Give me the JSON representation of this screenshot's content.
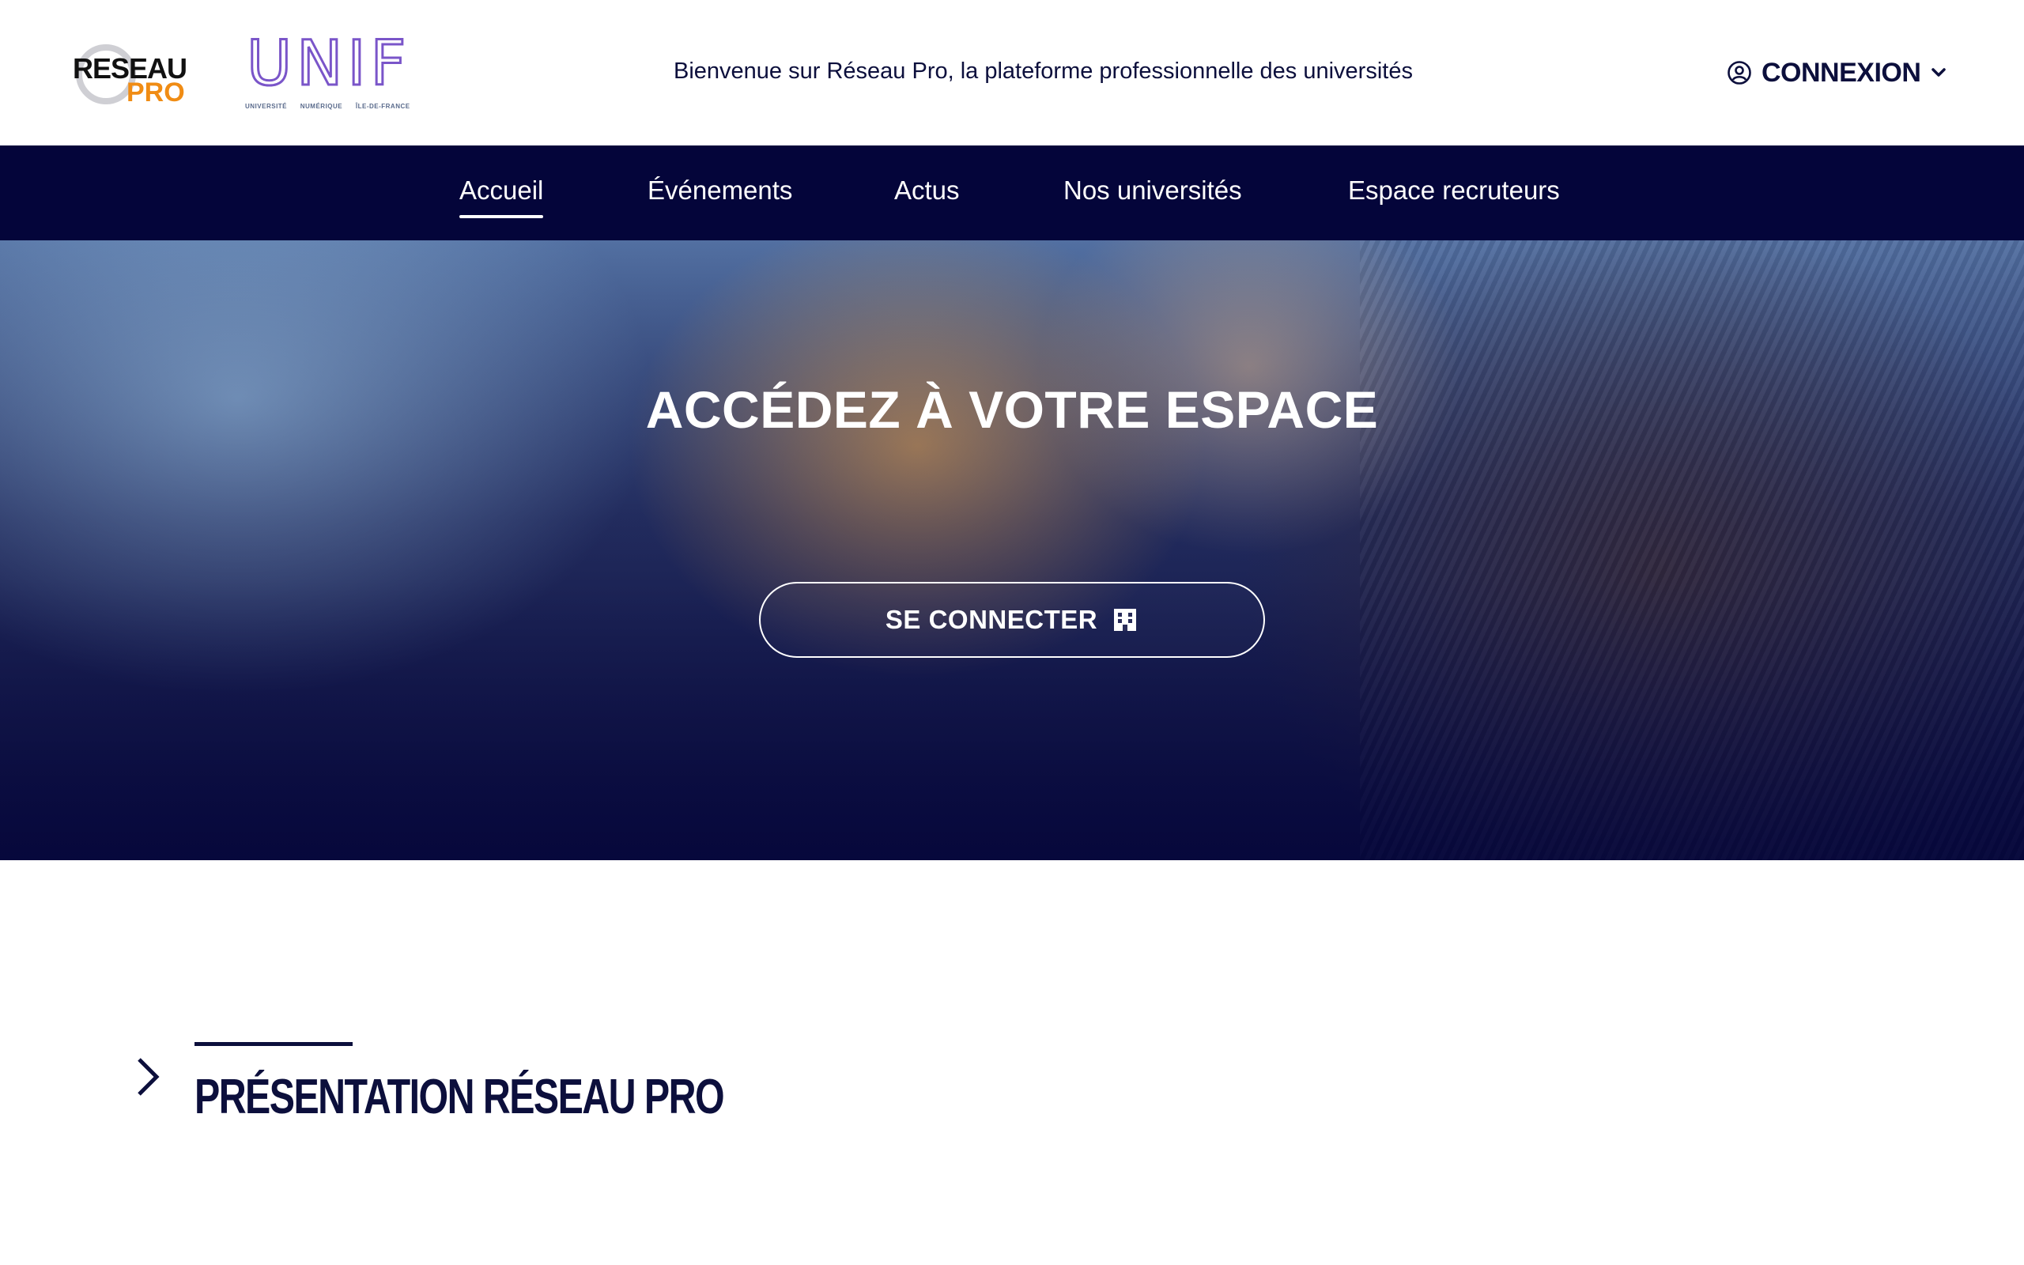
{
  "header": {
    "logo_reseau": {
      "line1": "RESEAU",
      "line2": "PRO"
    },
    "logo_unif": {
      "name": "UNIF",
      "tagline": [
        "UNIVERSITÉ",
        "NUMÉRIQUE",
        "ÎLE-DE-FRANCE"
      ]
    },
    "welcome": "Bienvenue sur Réseau Pro, la plateforme professionnelle des universités",
    "login_label": "CONNEXION",
    "login_icon": "user-circle-icon"
  },
  "nav": {
    "items": [
      {
        "label": "Accueil",
        "active": true
      },
      {
        "label": "Événements",
        "active": false
      },
      {
        "label": "Actus",
        "active": false
      },
      {
        "label": "Nos universités",
        "active": false
      },
      {
        "label": "Espace recruteurs",
        "active": false
      }
    ]
  },
  "hero": {
    "headline": "ACCÉDEZ À VOTRE ESPACE",
    "cta_label": "SE CONNECTER",
    "cta_icon": "building-icon"
  },
  "presentation": {
    "title": "PRÉSENTATION RÉSEAU PRO"
  },
  "colors": {
    "navy": "#04053a",
    "text": "#0c0f3c",
    "orange": "#f08c14",
    "unif_purple": "#7a55c9"
  }
}
